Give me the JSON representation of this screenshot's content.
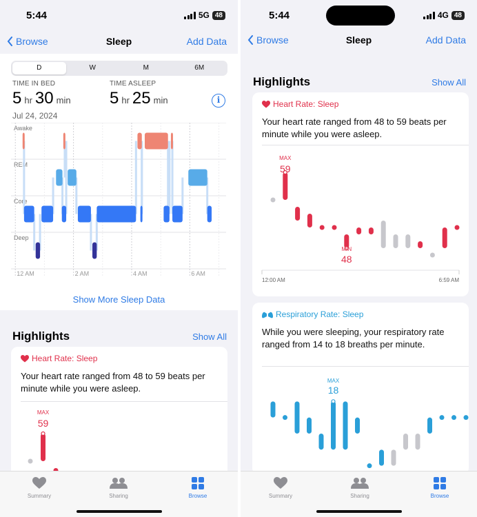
{
  "colors": {
    "accent": "#2f7be5",
    "heart": "#e0304b",
    "resp": "#2a9fd8",
    "awake": "#ee8573",
    "rem": "#58abe8",
    "core": "#3478f6",
    "deep": "#333399"
  },
  "left": {
    "status": {
      "time": "5:44",
      "network": "5G",
      "battery": "48"
    },
    "nav": {
      "back": "Browse",
      "title": "Sleep",
      "action": "Add Data"
    },
    "segments": [
      "D",
      "W",
      "M",
      "6M"
    ],
    "selected_segment": "D",
    "time_in_bed": {
      "label": "TIME IN BED",
      "hr": "5",
      "hr_unit": "hr",
      "min": "30",
      "min_unit": "min"
    },
    "time_asleep": {
      "label": "TIME ASLEEP",
      "hr": "5",
      "hr_unit": "hr",
      "min": "25",
      "min_unit": "min"
    },
    "info_glyph": "i",
    "date": "Jul 24, 2024",
    "show_more": "Show More Sleep Data",
    "highlights": {
      "title": "Highlights",
      "show_all": "Show All"
    },
    "card": {
      "title": "Heart Rate: Sleep",
      "text": "Your heart rate ranged from 48 to 59 beats per minute while you were asleep.",
      "max_label": "MAX",
      "max_value": "59"
    }
  },
  "right": {
    "status": {
      "time": "5:44",
      "network": "4G",
      "battery": "48"
    },
    "nav": {
      "back": "Browse",
      "title": "Sleep",
      "action": "Add Data"
    },
    "highlights": {
      "title": "Highlights",
      "show_all": "Show All"
    },
    "hr_card": {
      "title": "Heart Rate: Sleep",
      "text": "Your heart rate ranged from 48 to 59 beats per minute while you were asleep.",
      "max_label": "MAX",
      "max_value": "59",
      "min_label": "MIN",
      "min_value": "48",
      "x_start": "12:00 AM",
      "x_end": "6:59 AM"
    },
    "resp_card": {
      "title": "Respiratory Rate: Sleep",
      "text": "While you were sleeping, your respiratory rate ranged from 14 to 18 breaths per minute.",
      "max_label": "MAX",
      "max_value": "18"
    }
  },
  "tabs": [
    {
      "label": "Summary",
      "icon": "heart-icon"
    },
    {
      "label": "Sharing",
      "icon": "people-icon"
    },
    {
      "label": "Browse",
      "icon": "grid-icon"
    }
  ],
  "chart_data": [
    {
      "type": "bar",
      "title": "",
      "stages": [
        "Awake",
        "REM",
        "Core",
        "Deep"
      ],
      "x_ticks": [
        "12 AM",
        "2 AM",
        "4 AM",
        "6 AM"
      ],
      "xlim": [
        -0.1,
        7.2
      ],
      "segments": [
        {
          "stage": "Awake",
          "start": 0.25,
          "end": 0.3
        },
        {
          "stage": "Awake",
          "start": 1.65,
          "end": 1.7
        },
        {
          "stage": "Awake",
          "start": 4.2,
          "end": 4.35
        },
        {
          "stage": "Awake",
          "start": 4.45,
          "end": 5.25
        },
        {
          "stage": "Awake",
          "start": 5.35,
          "end": 5.4
        },
        {
          "stage": "REM",
          "start": 1.4,
          "end": 1.62
        },
        {
          "stage": "REM",
          "start": 1.8,
          "end": 2.1
        },
        {
          "stage": "REM",
          "start": 5.95,
          "end": 6.6
        },
        {
          "stage": "Core",
          "start": 0.3,
          "end": 0.65
        },
        {
          "stage": "Core",
          "start": 0.9,
          "end": 1.3
        },
        {
          "stage": "Core",
          "start": 1.6,
          "end": 1.75
        },
        {
          "stage": "Core",
          "start": 2.15,
          "end": 2.6
        },
        {
          "stage": "Core",
          "start": 2.8,
          "end": 4.15
        },
        {
          "stage": "Core",
          "start": 4.3,
          "end": 4.35
        },
        {
          "stage": "Core",
          "start": 5.1,
          "end": 5.3
        },
        {
          "stage": "Core",
          "start": 5.4,
          "end": 5.75
        },
        {
          "stage": "Core",
          "start": 6.6,
          "end": 6.75
        },
        {
          "stage": "Deep",
          "start": 0.7,
          "end": 0.85
        },
        {
          "stage": "Deep",
          "start": 2.65,
          "end": 2.8
        }
      ]
    },
    {
      "type": "bar",
      "title": "Heart Rate: Sleep",
      "x_labels": [
        "12:00 AM",
        "6:59 AM"
      ],
      "ylim": [
        44,
        62
      ],
      "ranges": [
        {
          "lo": 55,
          "hi": 55,
          "c": "gray"
        },
        {
          "lo": 55,
          "hi": 59,
          "c": "red"
        },
        {
          "lo": 52,
          "hi": 54,
          "c": "red"
        },
        {
          "lo": 51,
          "hi": 53,
          "c": "red"
        },
        {
          "lo": 51,
          "hi": 51,
          "c": "red"
        },
        {
          "lo": 51,
          "hi": 51,
          "c": "red"
        },
        {
          "lo": 48,
          "hi": 50,
          "c": "red"
        },
        {
          "lo": 50,
          "hi": 51,
          "c": "red"
        },
        {
          "lo": 50,
          "hi": 51,
          "c": "red"
        },
        {
          "lo": 48,
          "hi": 52,
          "c": "gray"
        },
        {
          "lo": 48,
          "hi": 50,
          "c": "gray"
        },
        {
          "lo": 48,
          "hi": 50,
          "c": "gray"
        },
        {
          "lo": 48,
          "hi": 49,
          "c": "red"
        },
        {
          "lo": 47,
          "hi": 47,
          "c": "gray"
        },
        {
          "lo": 48,
          "hi": 51,
          "c": "red"
        },
        {
          "lo": 51,
          "hi": 51,
          "c": "red"
        }
      ]
    },
    {
      "type": "bar",
      "title": "Respiratory Rate: Sleep",
      "ylim": [
        13,
        19
      ],
      "ranges": [
        {
          "lo": 17,
          "hi": 18,
          "c": "blue"
        },
        {
          "lo": 17,
          "hi": 17,
          "c": "blue"
        },
        {
          "lo": 16,
          "hi": 18,
          "c": "blue"
        },
        {
          "lo": 16,
          "hi": 17,
          "c": "blue"
        },
        {
          "lo": 15,
          "hi": 16,
          "c": "blue"
        },
        {
          "lo": 15,
          "hi": 18,
          "c": "blue"
        },
        {
          "lo": 15,
          "hi": 18,
          "c": "blue"
        },
        {
          "lo": 16,
          "hi": 17,
          "c": "blue"
        },
        {
          "lo": 14,
          "hi": 14,
          "c": "blue"
        },
        {
          "lo": 14,
          "hi": 15,
          "c": "blue"
        },
        {
          "lo": 14,
          "hi": 15,
          "c": "gray"
        },
        {
          "lo": 15,
          "hi": 16,
          "c": "gray"
        },
        {
          "lo": 15,
          "hi": 16,
          "c": "gray"
        },
        {
          "lo": 16,
          "hi": 17,
          "c": "blue"
        },
        {
          "lo": 17,
          "hi": 17,
          "c": "blue"
        },
        {
          "lo": 17,
          "hi": 17,
          "c": "blue"
        },
        {
          "lo": 17,
          "hi": 17,
          "c": "blue"
        }
      ]
    }
  ]
}
